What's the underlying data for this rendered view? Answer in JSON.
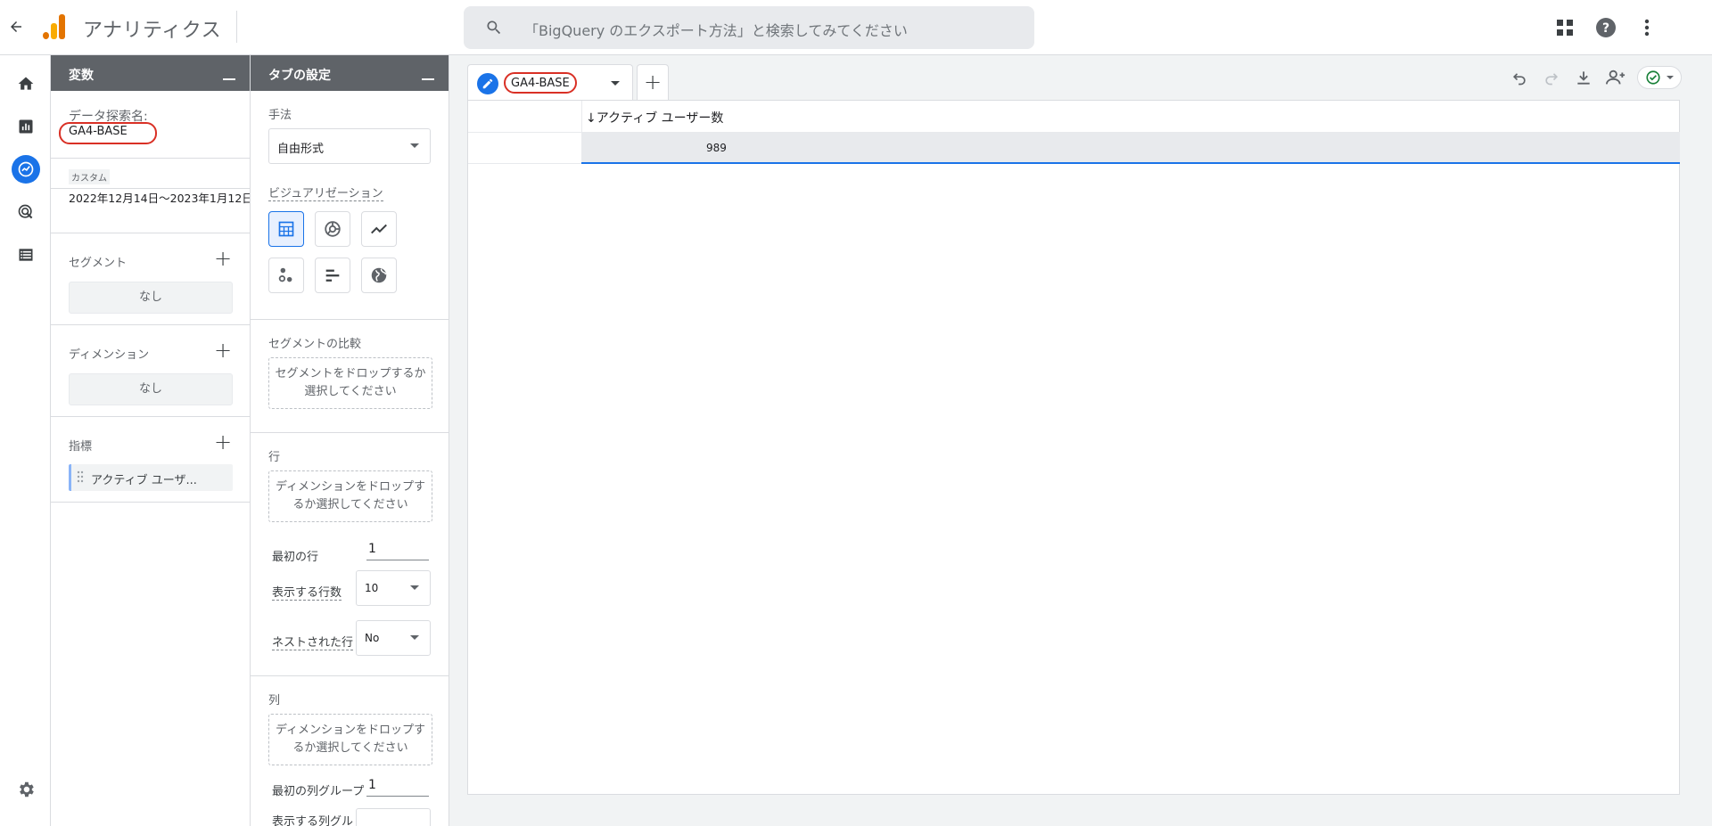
{
  "header": {
    "app_title": "アナリティクス",
    "search_placeholder": "「BigQuery のエクスポート方法」と検索してみてください"
  },
  "variables_panel": {
    "title": "変数",
    "exploration_name_label": "データ探索名:",
    "exploration_name": "GA4-BASE",
    "date_badge": "カスタム",
    "date_range": "2022年12月14日～2023年1月12日",
    "segments_label": "セグメント",
    "segments_empty": "なし",
    "dimensions_label": "ディメンション",
    "dimensions_empty": "なし",
    "metrics_label": "指標",
    "metric_item": "アクティブ ユーザ..."
  },
  "tab_settings": {
    "title": "タブの設定",
    "technique_label": "手法",
    "technique_value": "自由形式",
    "visualization_label": "ビジュアリゼーション",
    "segment_compare_label": "セグメントの比較",
    "segment_compare_drop": "セグメントをドロップするか選択してください",
    "rows_label": "行",
    "rows_drop": "ディメンションをドロップするか選択してください",
    "first_row_label": "最初の行",
    "first_row_value": "1",
    "show_rows_label": "表示する行数",
    "show_rows_value": "10",
    "nested_rows_label": "ネストされた行",
    "nested_rows_value": "No",
    "columns_label": "列",
    "columns_drop": "ディメンションをドロップするか選択してください",
    "first_col_group_label": "最初の列グループ",
    "first_col_group_value": "1",
    "show_col_groups_label": "表示する列グル"
  },
  "canvas": {
    "tab_name": "GA4-BASE",
    "column_header": "↓アクティブ ユーザー数",
    "total_value": "989"
  },
  "colors": {
    "accent": "#1a73e8",
    "panel_header": "#5f6368",
    "highlight_oval": "#d93025"
  }
}
